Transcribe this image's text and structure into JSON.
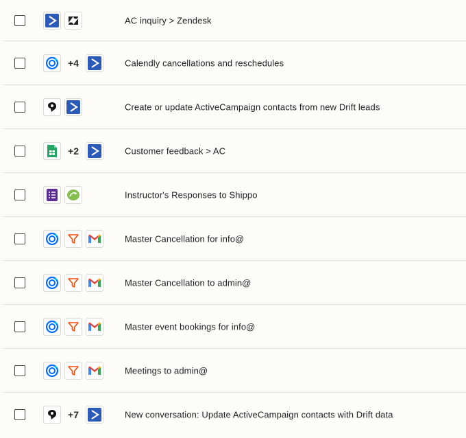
{
  "rows": [
    {
      "title": "AC inquiry > Zendesk",
      "icons": [
        "activecampaign-icon",
        "zendesk-icon"
      ]
    },
    {
      "title": "Calendly cancellations and reschedules",
      "more": "+4",
      "icons": [
        "calendly-icon",
        "activecampaign-icon"
      ]
    },
    {
      "title": "Create or update ActiveCampaign contacts from new Drift leads",
      "icons": [
        "drift-icon",
        "activecampaign-icon"
      ]
    },
    {
      "title": "Customer feedback > AC",
      "more": "+2",
      "icons": [
        "google-sheets-icon",
        "activecampaign-icon"
      ]
    },
    {
      "title": "Instructor's Responses to Shippo",
      "icons": [
        "google-forms-icon",
        "shippo-icon"
      ]
    },
    {
      "title": "Master Cancellation for info@",
      "icons": [
        "calendly-icon",
        "filter-icon",
        "gmail-icon"
      ]
    },
    {
      "title": "Master Cancellation to admin@",
      "icons": [
        "calendly-icon",
        "filter-icon",
        "gmail-icon"
      ]
    },
    {
      "title": "Master event bookings for info@",
      "icons": [
        "calendly-icon",
        "filter-icon",
        "gmail-icon"
      ]
    },
    {
      "title": "Meetings to admin@",
      "icons": [
        "calendly-icon",
        "filter-icon",
        "gmail-icon"
      ]
    },
    {
      "title": "New conversation: Update ActiveCampaign contacts with Drift data",
      "more": "+7",
      "icons": [
        "drift-icon",
        "activecampaign-icon"
      ]
    }
  ],
  "colors": {
    "activecampaign": "#2c5ab8",
    "calendly": "#006bff",
    "filter": "#ff4a00",
    "sheets": "#23a566",
    "forms": "#5c2d91",
    "shippo": "#86c051"
  }
}
